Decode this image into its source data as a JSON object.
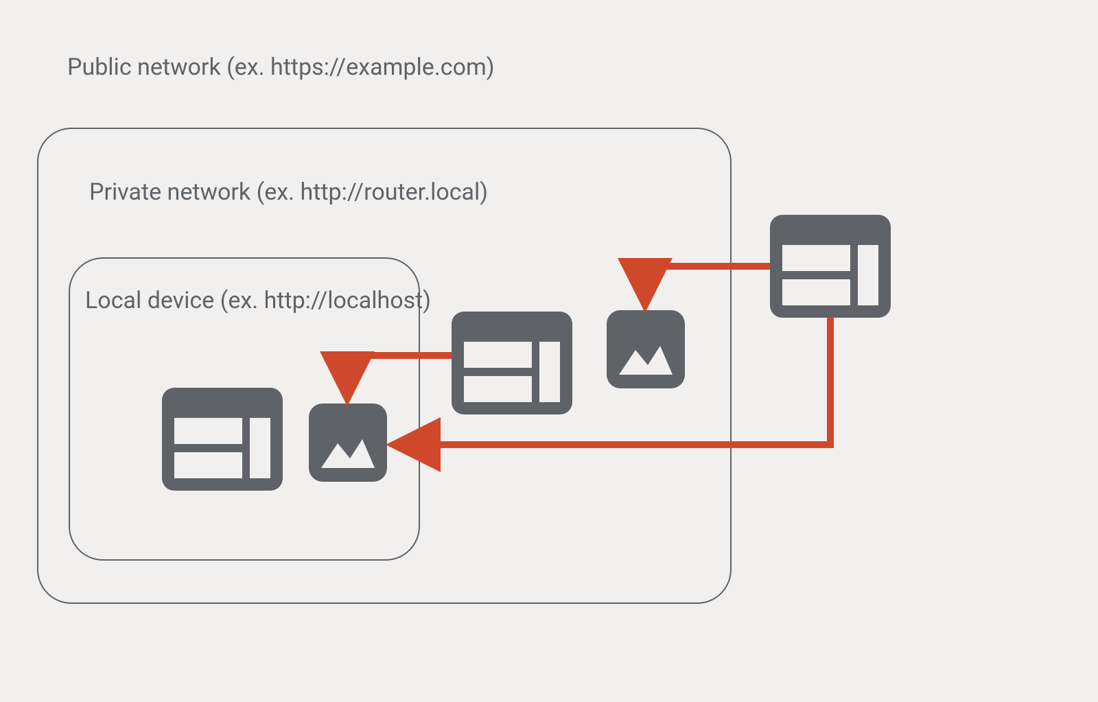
{
  "labels": {
    "public_network": "Public network (ex. https://example.com)",
    "private_network": "Private network (ex. http://router.local)",
    "local_device": "Local device (ex. http://localhost)"
  },
  "colors": {
    "background": "#f1f0ef",
    "border": "#5f6368",
    "text": "#5f6368",
    "icon_fill": "#5f6368",
    "arrow": "#d0482c"
  }
}
